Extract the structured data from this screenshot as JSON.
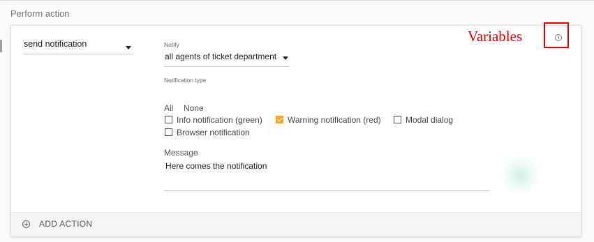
{
  "section": {
    "title": "Perform action"
  },
  "action": {
    "selected": "send notification"
  },
  "notify": {
    "label": "Notify",
    "selected": "all agents of ticket department"
  },
  "notification_type": {
    "label": "Notification type",
    "select_all": "All",
    "select_none": "None",
    "options": [
      {
        "label": "Info notification (green)",
        "checked": false
      },
      {
        "label": "Warning notification (red)",
        "checked": true
      },
      {
        "label": "Modal dialog",
        "checked": false
      },
      {
        "label": "Browser notification",
        "checked": false
      }
    ]
  },
  "message": {
    "label": "Message",
    "value": "Here comes the notification"
  },
  "footer": {
    "add_action_label": "ADD ACTION"
  },
  "annotation": {
    "text": "Variables",
    "color": "#e00000"
  },
  "icons": {
    "variables_info": "info-icon",
    "add_action": "plus-circle-icon",
    "dropdown": "chevron-down-icon"
  },
  "colors": {
    "checkbox_checked": "#f5a623",
    "card_background": "#ffffff"
  }
}
